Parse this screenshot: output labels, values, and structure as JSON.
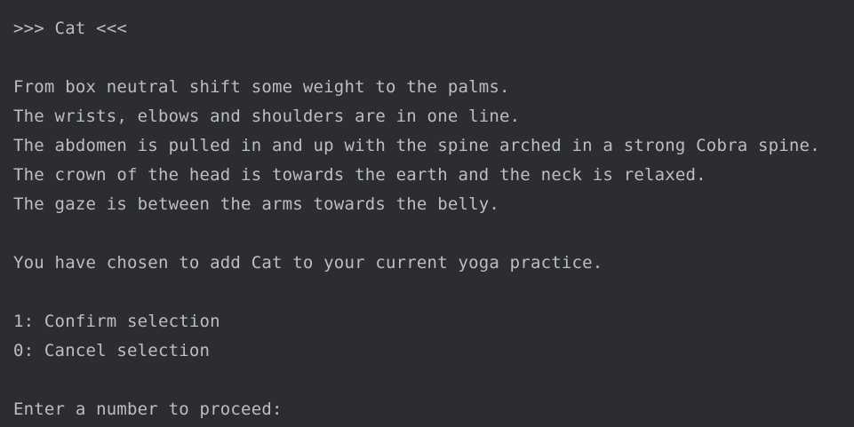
{
  "console": {
    "header": ">>> Cat <<<",
    "description": [
      "From box neutral shift some weight to the palms.",
      "The wrists, elbows and shoulders are in one line.",
      "The abdomen is pulled in and up with the spine arched in a strong Cobra spine.",
      "The crown of the head is towards the earth and the neck is relaxed.",
      "The gaze is between the arms towards the belly."
    ],
    "message": "You have chosen to add Cat to your current yoga practice.",
    "options": [
      "1: Confirm selection",
      "0: Cancel selection"
    ],
    "prompt": "Enter a number to proceed:"
  },
  "colors": {
    "background": "#2b2d30",
    "text": "#bcbec4"
  }
}
